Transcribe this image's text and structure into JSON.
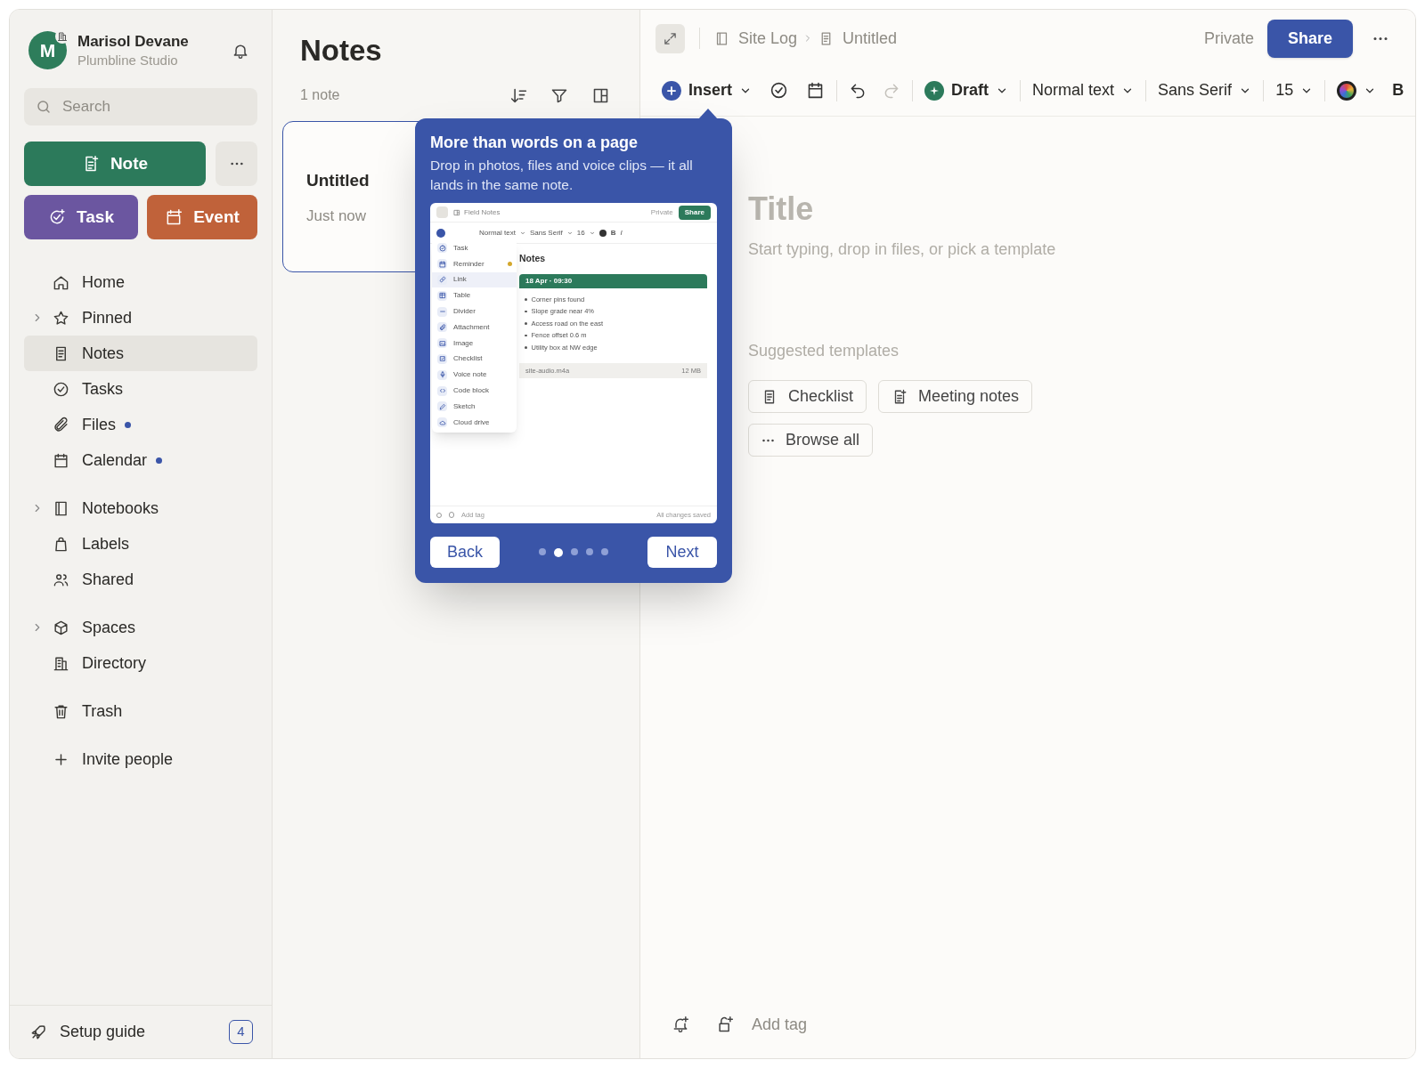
{
  "sidebar": {
    "user": {
      "initial": "M",
      "name": "Marisol Devane",
      "org": "Plumbline Studio"
    },
    "search": {
      "placeholder": "Search"
    },
    "actions": [
      {
        "kind": "note",
        "label": "Note"
      },
      {
        "kind": "task",
        "label": "Task"
      },
      {
        "kind": "event",
        "label": "Event"
      }
    ],
    "nav_groups": [
      [
        {
          "label": "Home",
          "selected": false
        },
        {
          "label": "Pinned",
          "selected": false,
          "expanded": false
        },
        {
          "label": "Notes",
          "selected": true
        },
        {
          "label": "Tasks",
          "selected": false
        },
        {
          "label": "Files",
          "selected": false,
          "unread": true
        },
        {
          "label": "Calendar",
          "selected": false,
          "unread": true
        }
      ],
      [
        {
          "label": "Notebooks",
          "selected": false,
          "expanded": false
        },
        {
          "label": "Labels",
          "selected": false
        },
        {
          "label": "Shared",
          "selected": false
        }
      ],
      [
        {
          "label": "Spaces",
          "selected": false,
          "expanded": false
        },
        {
          "label": "Directory",
          "selected": false
        }
      ],
      [
        {
          "label": "Trash",
          "selected": false
        }
      ],
      [
        {
          "label": "Invite people",
          "selected": false
        }
      ]
    ],
    "setup_guide": {
      "label": "Setup guide",
      "count": "4"
    }
  },
  "notes_list": {
    "title": "Notes",
    "count": "1 note",
    "notes": [
      {
        "title": "Untitled",
        "time": "Just now",
        "selected": true
      }
    ]
  },
  "editor": {
    "breadcrumb": [
      "Site Log",
      "Untitled"
    ],
    "visibility": "Private",
    "share": "Share",
    "toolbar": {
      "insert": "Insert",
      "status": "Draft",
      "text_style": "Normal text",
      "font": "Sans Serif",
      "size": "15",
      "bold": "B"
    },
    "title_placeholder": "Title",
    "body_placeholder": "Start typing, drop in files, or pick a template",
    "templates_heading": "Suggested templates",
    "templates": [
      {
        "kind": "checklist",
        "label": "Checklist"
      },
      {
        "kind": "meeting",
        "label": "Meeting notes"
      },
      {
        "kind": "more",
        "label": "Browse all"
      }
    ],
    "tag_placeholder": "Add tag"
  },
  "tour": {
    "title": "More than words on a page",
    "text": "Drop in photos, files and voice clips — it all lands in the same note.",
    "preview": {
      "title": "Field Notes",
      "visibility": "Private",
      "share": "Share",
      "text_style": "Normal text",
      "font": "Sans Serif",
      "size": "16",
      "bold": "B",
      "italic": "I",
      "menu": [
        {
          "label": "Task",
          "selected": false,
          "dot": false
        },
        {
          "label": "Reminder",
          "selected": false,
          "dot": true
        },
        {
          "label": "Link",
          "selected": true,
          "dot": false
        },
        {
          "label": "Table",
          "selected": false,
          "dot": false
        },
        {
          "label": "Divider",
          "selected": false,
          "dot": false
        },
        {
          "label": "Attachment",
          "selected": false,
          "dot": false
        },
        {
          "label": "Image",
          "selected": false,
          "dot": false
        },
        {
          "label": "Checklist",
          "selected": false,
          "dot": false
        },
        {
          "label": "Voice note",
          "selected": false,
          "dot": false
        },
        {
          "label": "Code block",
          "selected": false,
          "dot": false
        },
        {
          "label": "Sketch",
          "selected": false,
          "dot": false
        },
        {
          "label": "Cloud drive",
          "selected": false,
          "dot": false
        }
      ],
      "heading": "Notes",
      "date": "18 Apr · 09:30",
      "bullets": [
        "Corner pins found",
        "Slope grade near 4%",
        "Access road on the east",
        "Fence offset 0.6 m",
        "Utility box at NW edge"
      ],
      "file": {
        "name": "site-audio.m4a",
        "size": "12 MB"
      },
      "tag_placeholder": "Add tag",
      "saved": "All changes saved"
    },
    "back": "Back",
    "next": "Next",
    "steps": [
      {
        "selected": false
      },
      {
        "selected": true
      },
      {
        "selected": false
      },
      {
        "selected": false
      },
      {
        "selected": false
      }
    ]
  }
}
